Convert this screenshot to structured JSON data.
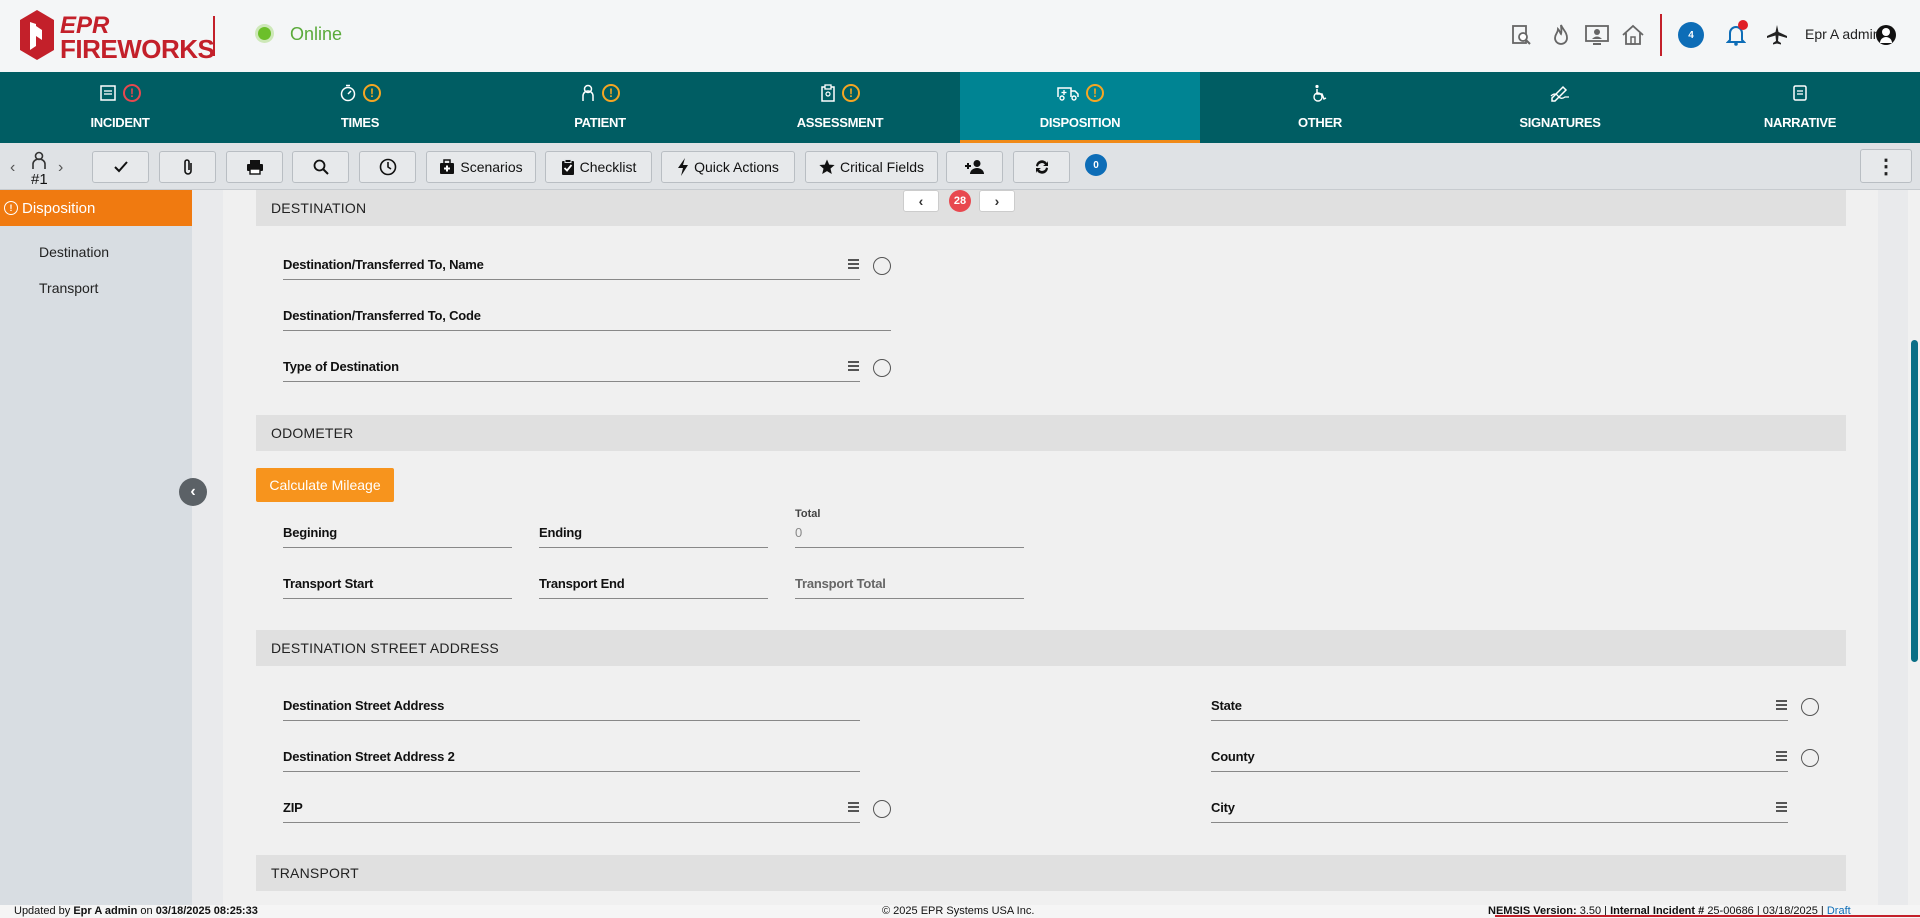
{
  "header": {
    "logo_line1": "EPR",
    "logo_line2": "FIREWORKS",
    "status": "Online",
    "chat_count": "4",
    "user_name": "Epr A admin",
    "icons": [
      "search-document-icon",
      "fire-icon",
      "monitor-user-icon",
      "home-icon",
      "chat-icon",
      "bell-icon",
      "airplane-icon",
      "user-circle-icon"
    ]
  },
  "tabs": [
    {
      "label": "INCIDENT",
      "icon": "incident-icon",
      "warn": "red"
    },
    {
      "label": "TIMES",
      "icon": "stopwatch-icon",
      "warn": "orange"
    },
    {
      "label": "PATIENT",
      "icon": "person-icon",
      "warn": "orange"
    },
    {
      "label": "ASSESSMENT",
      "icon": "clipboard-icon",
      "warn": "orange"
    },
    {
      "label": "DISPOSITION",
      "icon": "ambulance-icon",
      "warn": "orange",
      "active": true
    },
    {
      "label": "OTHER",
      "icon": "wheelchair-icon",
      "warn": ""
    },
    {
      "label": "SIGNATURES",
      "icon": "signature-icon",
      "warn": ""
    },
    {
      "label": "NARRATIVE",
      "icon": "document-icon",
      "warn": ""
    }
  ],
  "toolbar": {
    "patient_number": "#1",
    "scenarios": "Scenarios",
    "checklist": "Checklist",
    "quick_actions": "Quick Actions",
    "critical_fields": "Critical Fields",
    "message_count": "0"
  },
  "sidebar": {
    "heading": "Disposition",
    "items": [
      "Destination",
      "Transport"
    ]
  },
  "main": {
    "pager_count": "28",
    "destination": {
      "title": "DESTINATION",
      "name_label": "Destination/Transferred To, Name",
      "code_label": "Destination/Transferred To, Code",
      "type_label": "Type of Destination"
    },
    "odometer": {
      "title": "ODOMETER",
      "calc_button": "Calculate Mileage",
      "beginning_label": "Begining",
      "ending_label": "Ending",
      "total_label": "Total",
      "total_value": "0",
      "transport_start_label": "Transport Start",
      "transport_end_label": "Transport End",
      "transport_total_label": "Transport Total"
    },
    "address": {
      "title": "DESTINATION STREET ADDRESS",
      "street_label": "Destination Street Address",
      "street2_label": "Destination Street Address 2",
      "zip_label": "ZIP",
      "state_label": "State",
      "county_label": "County",
      "city_label": "City"
    },
    "transport": {
      "title": "TRANSPORT"
    }
  },
  "footer": {
    "updated_prefix": "Updated by",
    "updated_user": "Epr A admin",
    "updated_on": "on",
    "updated_time": "03/18/2025 08:25:33",
    "copyright": "© 2025 EPR Systems USA Inc.",
    "nemsis_label": "NEMSIS Version:",
    "nemsis_value": "3.50",
    "incident_label": "Internal Incident #",
    "incident_value": "25-00686",
    "incident_date": "03/18/2025",
    "draft": "Draft"
  }
}
